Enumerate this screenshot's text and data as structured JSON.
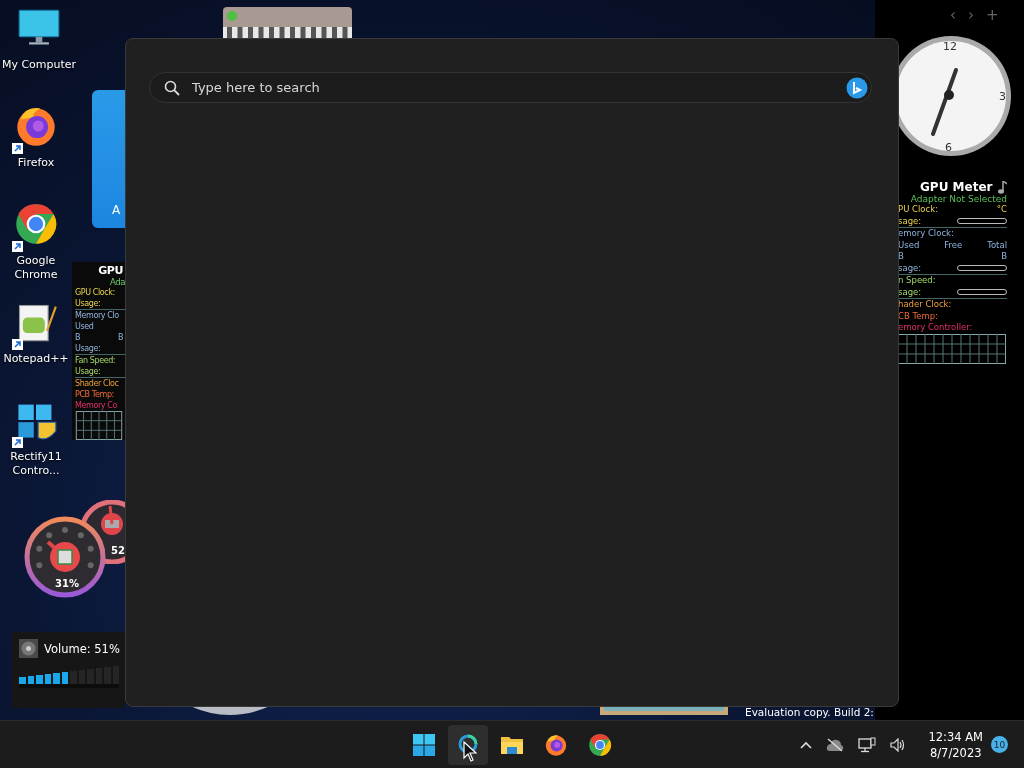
{
  "desktop_icons": [
    {
      "label": "My Computer",
      "kind": "computer",
      "shortcut": false
    },
    {
      "label": "Firefox",
      "kind": "firefox",
      "shortcut": true
    },
    {
      "label": "Google Chrome",
      "kind": "chrome",
      "shortcut": true
    },
    {
      "label": "Notepad++",
      "kind": "notepad",
      "shortcut": true
    },
    {
      "label": "Rectify11 Contro...",
      "kind": "rectify",
      "shortcut": true
    }
  ],
  "calendar_gadget": {
    "text": "A"
  },
  "gpu_meter_left": {
    "title": "GPU",
    "subtitle": "Ada",
    "rows": [
      {
        "cells": [
          "GPU Clock:"
        ],
        "kind": "gpu"
      },
      {
        "cells": [
          "Usage:"
        ],
        "kind": "gpu"
      },
      {
        "cells": [
          "Memory Clo"
        ],
        "kind": "memory"
      },
      {
        "cells": [
          "Used"
        ],
        "kind": "memory"
      },
      {
        "cells": [
          "B",
          "B"
        ],
        "kind": "memory"
      },
      {
        "cells": [
          "Usage:"
        ],
        "kind": "memory"
      },
      {
        "cells": [
          "Fan Speed:"
        ],
        "kind": "fan"
      },
      {
        "cells": [
          "Usage:"
        ],
        "kind": "fan"
      },
      {
        "cells": [
          "Shader Cloc"
        ],
        "kind": "shader"
      },
      {
        "cells": [
          "PCB Temp:"
        ],
        "kind": "pcb"
      },
      {
        "cells": [
          "Memory Co"
        ],
        "kind": "controller"
      }
    ]
  },
  "gauges": [
    {
      "reading": "31%"
    },
    {
      "reading": "52"
    }
  ],
  "volume_gadget": {
    "label": "Volume: 51%",
    "level": 0.5
  },
  "clock_gadget": {
    "nav": [
      "‹",
      "›",
      "+"
    ],
    "numerals": [
      "12",
      "3",
      "6"
    ]
  },
  "gpu_meter_right": {
    "title": "GPU Meter",
    "subtitle": "Adapter Not Selected",
    "rows": [
      {
        "cells": [
          "PU Clock:",
          "°C"
        ],
        "kind": "gpu"
      },
      {
        "cells": [
          "sage:",
          {
            "kind": "bar"
          }
        ],
        "kind": "gpu"
      },
      {
        "cells": [
          "emory Clock:"
        ],
        "kind": "memory"
      },
      {
        "cells": [
          "Used",
          "Free",
          "Total"
        ],
        "kind": "memory"
      },
      {
        "cells": [
          "B",
          "B"
        ],
        "kind": "memory"
      },
      {
        "cells": [
          "sage:",
          {
            "kind": "bar"
          }
        ],
        "kind": "memory"
      },
      {
        "cells": [
          "n Speed:"
        ],
        "kind": "fan"
      },
      {
        "cells": [
          "sage:",
          {
            "kind": "bar"
          }
        ],
        "kind": "fan"
      },
      {
        "cells": [
          "hader Clock:"
        ],
        "kind": "shader"
      },
      {
        "cells": [
          "CB Temp:"
        ],
        "kind": "pcb"
      },
      {
        "cells": [
          "emory Controller:"
        ],
        "kind": "controller"
      }
    ]
  },
  "watermark": "Evaluation copy. Build 2:",
  "search_panel": {
    "placeholder": "Type here to search"
  },
  "taskbar": {
    "apps": [
      {
        "kind": "start",
        "selected": false
      },
      {
        "kind": "search",
        "selected": true
      },
      {
        "kind": "explorer",
        "selected": false
      },
      {
        "kind": "firefox",
        "selected": false
      },
      {
        "kind": "chrome",
        "selected": false
      }
    ],
    "time": "12:34 AM",
    "date": "8/7/2023",
    "notifications": "10"
  }
}
